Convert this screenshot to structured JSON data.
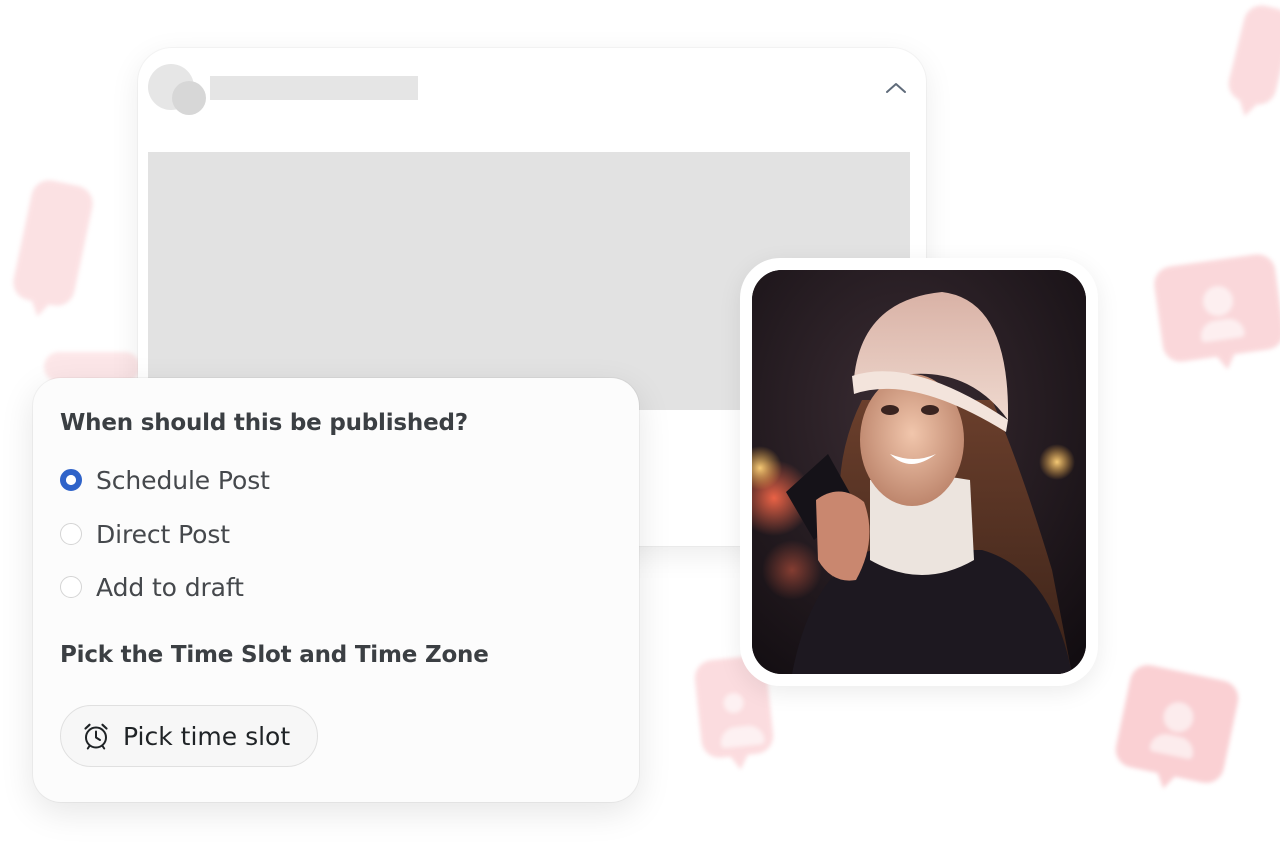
{
  "colors": {
    "accent": "#2f63c9",
    "heading_text": "#3b3f43",
    "body_text": "#45484c",
    "decoration": "#f7a8ae"
  },
  "post_preview": {
    "collapse_icon": "chevron-up-icon"
  },
  "publish_options": {
    "question": "When should this be published?",
    "selected": "Schedule Post",
    "options": [
      {
        "label": "Schedule Post"
      },
      {
        "label": "Direct Post"
      },
      {
        "label": "Add to draft"
      }
    ],
    "time_heading": "Pick the Time Slot and Time Zone",
    "pick_button": {
      "label": "Pick time slot",
      "icon": "alarm-clock-icon"
    }
  }
}
